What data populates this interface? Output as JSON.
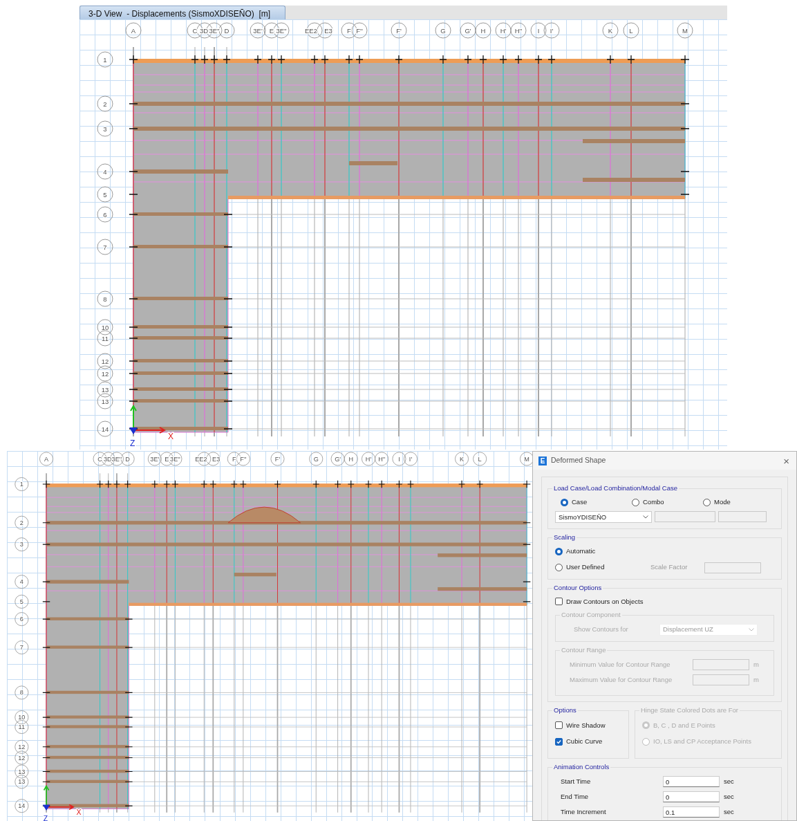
{
  "views": [
    {
      "title": "3-D View  - Displacements (SismoXDISEÑO)  [m]",
      "column_labels": [
        "A",
        "C",
        "3D'",
        "3E''",
        "D",
        "3E'",
        "E",
        "3E''",
        "EE2",
        "E3",
        "F",
        "F''",
        "F'",
        "G",
        "G'",
        "H",
        "H'",
        "H''",
        "I",
        "I'",
        "K",
        "L",
        "M"
      ],
      "row_labels": [
        "1",
        "2",
        "3",
        "4",
        "5",
        "6",
        "7",
        "8",
        "10",
        "11",
        "12",
        "12",
        "13",
        "13",
        "14"
      ],
      "axis_labels": [
        "X",
        "Z"
      ]
    },
    {
      "column_labels": [
        "A",
        "C",
        "3D'",
        "3E''",
        "D",
        "3E'",
        "E",
        "3E''",
        "EE2",
        "E3",
        "F",
        "F''",
        "F'",
        "G",
        "G'",
        "H",
        "H'",
        "H''",
        "I",
        "I'",
        "K",
        "L",
        "M"
      ],
      "row_labels": [
        "1",
        "2",
        "3",
        "4",
        "5",
        "6",
        "7",
        "8",
        "10",
        "11",
        "12",
        "12",
        "13",
        "13",
        "14"
      ],
      "axis_labels": [
        "X",
        "Z"
      ]
    }
  ],
  "dialog": {
    "icon_letter": "E",
    "title": "Deformed Shape",
    "close": "×",
    "load_case": {
      "legend": "Load Case/Load Combination/Modal Case",
      "options": [
        {
          "label": "Case",
          "selected": true
        },
        {
          "label": "Combo",
          "selected": false
        },
        {
          "label": "Mode",
          "selected": false
        }
      ],
      "value": "SismoYDISEÑO"
    },
    "scaling": {
      "legend": "Scaling",
      "options": [
        {
          "label": "Automatic",
          "selected": true
        },
        {
          "label": "User Defined",
          "selected": false
        }
      ],
      "scale_factor_label": "Scale Factor"
    },
    "contour_options": {
      "legend": "Contour Options",
      "draw_contours": {
        "label": "Draw Contours on Objects",
        "checked": false
      },
      "component_legend": "Contour Component",
      "show_label": "Show Contours for",
      "show_value": "Displacement UZ",
      "range_legend": "Contour Range",
      "range_rows": [
        {
          "label": "Minimum Value for Contour Range",
          "unit": "m"
        },
        {
          "label": "Maximum Value for Contour Range",
          "unit": "m"
        }
      ]
    },
    "options": {
      "legend": "Options",
      "checkboxes": [
        {
          "label": "Wire Shadow",
          "checked": false
        },
        {
          "label": "Cubic Curve",
          "checked": true
        }
      ]
    },
    "hinge": {
      "legend": "Hinge State Colored Dots are For",
      "disabled": true,
      "options": [
        {
          "label": "B, C , D and E Points",
          "selected": true
        },
        {
          "label": "IO, LS and CP Acceptance Points",
          "selected": false
        }
      ]
    },
    "animation": {
      "legend": "Animation Controls",
      "rows": [
        {
          "label": "Start Time",
          "value": "0",
          "unit": "sec"
        },
        {
          "label": "End Time",
          "value": "0",
          "unit": "sec"
        },
        {
          "label": "Time Increment",
          "value": "0.1",
          "unit": "sec"
        }
      ]
    }
  }
}
